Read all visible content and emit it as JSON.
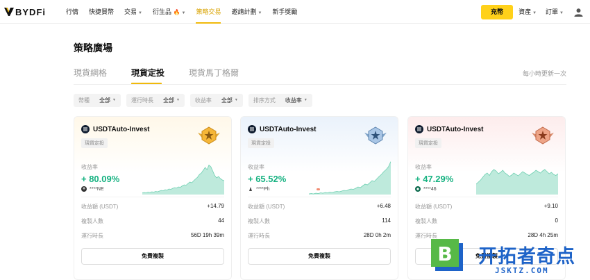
{
  "brand": {
    "name": "BYDFi"
  },
  "nav": {
    "items": [
      {
        "label": "行情",
        "dropdown": false
      },
      {
        "label": "快捷買幣",
        "dropdown": false
      },
      {
        "label": "交易",
        "dropdown": true
      },
      {
        "label": "衍生品",
        "dropdown": true,
        "fire": true
      },
      {
        "label": "策略交易",
        "dropdown": false,
        "active": true
      },
      {
        "label": "邀請計劃",
        "dropdown": true
      },
      {
        "label": "新手獎勵",
        "dropdown": false
      }
    ],
    "deposit_label": "充幣",
    "assets_label": "資產",
    "orders_label": "訂單",
    "accent_color": "#f0b90b"
  },
  "page": {
    "title": "策略廣場",
    "tabs": [
      {
        "label": "現貨網格",
        "active": false
      },
      {
        "label": "現貨定投",
        "active": true
      },
      {
        "label": "現貨馬丁格爾",
        "active": false
      }
    ],
    "refresh_note": "每小時更新一次"
  },
  "filters": [
    {
      "label": "幣種",
      "value": "全部"
    },
    {
      "label": "運行時長",
      "value": "全部"
    },
    {
      "label": "收益率",
      "value": "全部"
    },
    {
      "label": "排序方式",
      "value": "收益率"
    }
  ],
  "cards": [
    {
      "rank": "gold",
      "name": "USDTAuto-Invest",
      "tag": "現貨定投",
      "rate_label": "收益率",
      "rate": "+ 80.09%",
      "user": "****NE",
      "profit_label": "收益額 (USDT)",
      "profit": "+14.79",
      "copies_label": "複製人數",
      "copies": "44",
      "runtime_label": "運行時長",
      "runtime": "56D 19h 39m",
      "button": "免費複製",
      "spark": [
        0.05,
        0.06,
        0.05,
        0.07,
        0.06,
        0.08,
        0.07,
        0.09,
        0.08,
        0.1,
        0.12,
        0.11,
        0.14,
        0.13,
        0.16,
        0.15,
        0.18,
        0.2,
        0.19,
        0.22,
        0.21,
        0.25,
        0.28,
        0.27,
        0.32,
        0.36,
        0.34,
        0.4,
        0.45,
        0.5,
        0.58,
        0.62,
        0.7,
        0.78,
        0.72,
        0.85,
        0.8,
        0.68,
        0.55,
        0.48,
        0.52,
        0.46,
        0.42,
        0.4
      ]
    },
    {
      "rank": "silver",
      "name": "USDTAuto-Invest",
      "tag": "現貨定投",
      "rate_label": "收益率",
      "rate": "+ 65.52%",
      "user": "****Ph",
      "profit_label": "收益額 (USDT)",
      "profit": "+6.48",
      "copies_label": "複製人數",
      "copies": "114",
      "runtime_label": "運行時長",
      "runtime": "28D 0h 2m",
      "button": "免費複製",
      "spark": [
        0.02,
        0.03,
        0.02,
        0.04,
        0.03,
        0.05,
        0.04,
        0.06,
        0.05,
        0.07,
        0.06,
        0.08,
        0.09,
        0.08,
        0.1,
        0.12,
        0.11,
        0.14,
        0.16,
        0.15,
        0.18,
        0.22,
        0.2,
        0.25,
        0.3,
        0.28,
        0.34,
        0.4,
        0.38,
        0.45,
        0.52,
        0.58,
        0.66,
        0.72,
        0.8,
        0.95
      ]
    },
    {
      "rank": "bronze",
      "name": "USDTAuto-Invest",
      "tag": "現貨定投",
      "rate_label": "收益率",
      "rate": "+ 47.29%",
      "user": "****46",
      "profit_label": "收益額 (USDT)",
      "profit": "+9.10",
      "copies_label": "複製人數",
      "copies": "0",
      "runtime_label": "運行時長",
      "runtime": "28D 4h 25m",
      "button": "免費複製",
      "spark": [
        0.3,
        0.36,
        0.42,
        0.5,
        0.58,
        0.62,
        0.55,
        0.66,
        0.72,
        0.68,
        0.6,
        0.64,
        0.7,
        0.62,
        0.58,
        0.52,
        0.56,
        0.62,
        0.58,
        0.54,
        0.6,
        0.66,
        0.62,
        0.58,
        0.55,
        0.6,
        0.64,
        0.7,
        0.66,
        0.62,
        0.68,
        0.72,
        0.66,
        0.6,
        0.64,
        0.58,
        0.55,
        0.6
      ]
    }
  ],
  "watermark": {
    "zh": "开拓者奇点",
    "en": "JSKTZ.COM",
    "letter": "B"
  }
}
